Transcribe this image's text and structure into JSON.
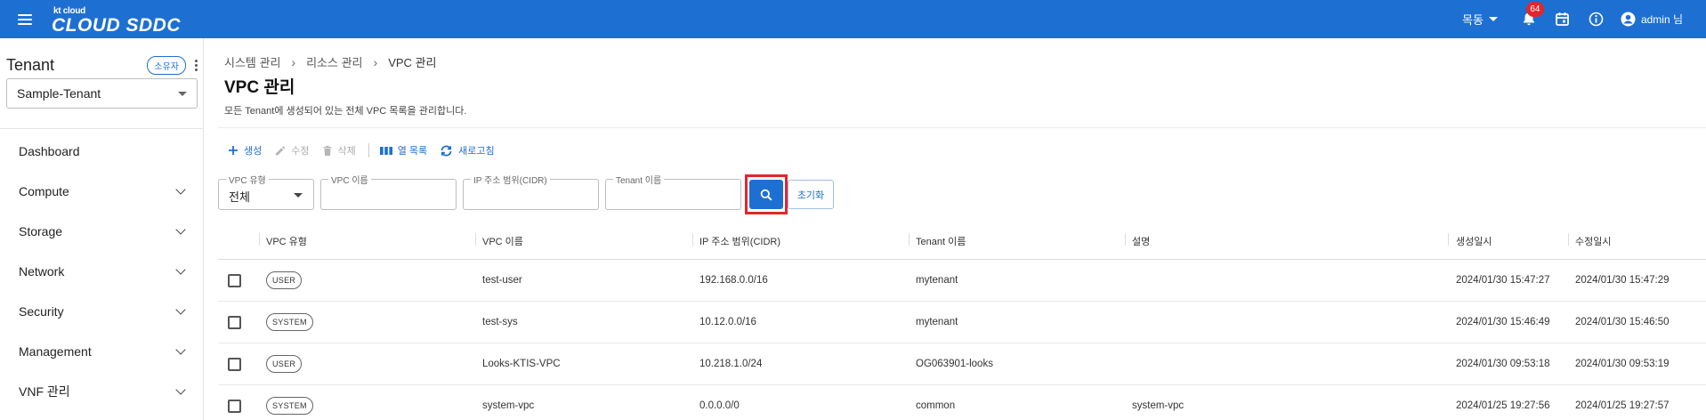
{
  "header": {
    "brand_small": "kt cloud",
    "brand_main": "CLOUD SDDC",
    "region": "목동",
    "notification_count": "64",
    "user_label": "admin 님",
    "bg_color": "#1e6fd2"
  },
  "sidebar": {
    "tenant_title": "Tenant",
    "owner_chip": "소유자",
    "tenant_selected": "Sample-Tenant",
    "items": [
      {
        "label": "Dashboard",
        "expandable": false
      },
      {
        "label": "Compute",
        "expandable": true
      },
      {
        "label": "Storage",
        "expandable": true
      },
      {
        "label": "Network",
        "expandable": true
      },
      {
        "label": "Security",
        "expandable": true
      },
      {
        "label": "Management",
        "expandable": true
      },
      {
        "label": "VNF 관리",
        "expandable": true
      }
    ]
  },
  "breadcrumb": [
    "시스템 관리",
    "리소스 관리",
    "VPC 관리"
  ],
  "page": {
    "title": "VPC 관리",
    "description": "모든 Tenant에 생성되어 있는 전체 VPC 목록을 관리합니다."
  },
  "toolbar": {
    "create": "생성",
    "edit": "수정",
    "delete": "삭제",
    "columns": "열 목록",
    "refresh": "새로고침"
  },
  "filters": {
    "vpc_type_label": "VPC 유형",
    "vpc_type_value": "전체",
    "vpc_name_label": "VPC 이름",
    "vpc_name_value": "",
    "cidr_label": "IP 주소 범위(CIDR)",
    "cidr_value": "",
    "tenant_label": "Tenant 이름",
    "tenant_value": "",
    "reset": "초기화"
  },
  "table": {
    "columns": [
      "VPC 유형",
      "VPC 이름",
      "IP 주소 범위(CIDR)",
      "Tenant 이름",
      "설명",
      "생성일시",
      "수정일시"
    ],
    "rows": [
      {
        "type": "USER",
        "name": "test-user",
        "cidr": "192.168.0.0/16",
        "tenant": "mytenant",
        "desc": "",
        "created": "2024/01/30 15:47:27",
        "modified": "2024/01/30 15:47:29"
      },
      {
        "type": "SYSTEM",
        "name": "test-sys",
        "cidr": "10.12.0.0/16",
        "tenant": "mytenant",
        "desc": "",
        "created": "2024/01/30 15:46:49",
        "modified": "2024/01/30 15:46:50"
      },
      {
        "type": "USER",
        "name": "Looks-KTIS-VPC",
        "cidr": "10.218.1.0/24",
        "tenant": "OG063901-looks",
        "desc": "",
        "created": "2024/01/30 09:53:18",
        "modified": "2024/01/30 09:53:19"
      },
      {
        "type": "SYSTEM",
        "name": "system-vpc",
        "cidr": "0.0.0.0/0",
        "tenant": "common",
        "desc": "system-vpc",
        "created": "2024/01/25 19:27:56",
        "modified": "2024/01/25 19:27:57"
      }
    ]
  }
}
